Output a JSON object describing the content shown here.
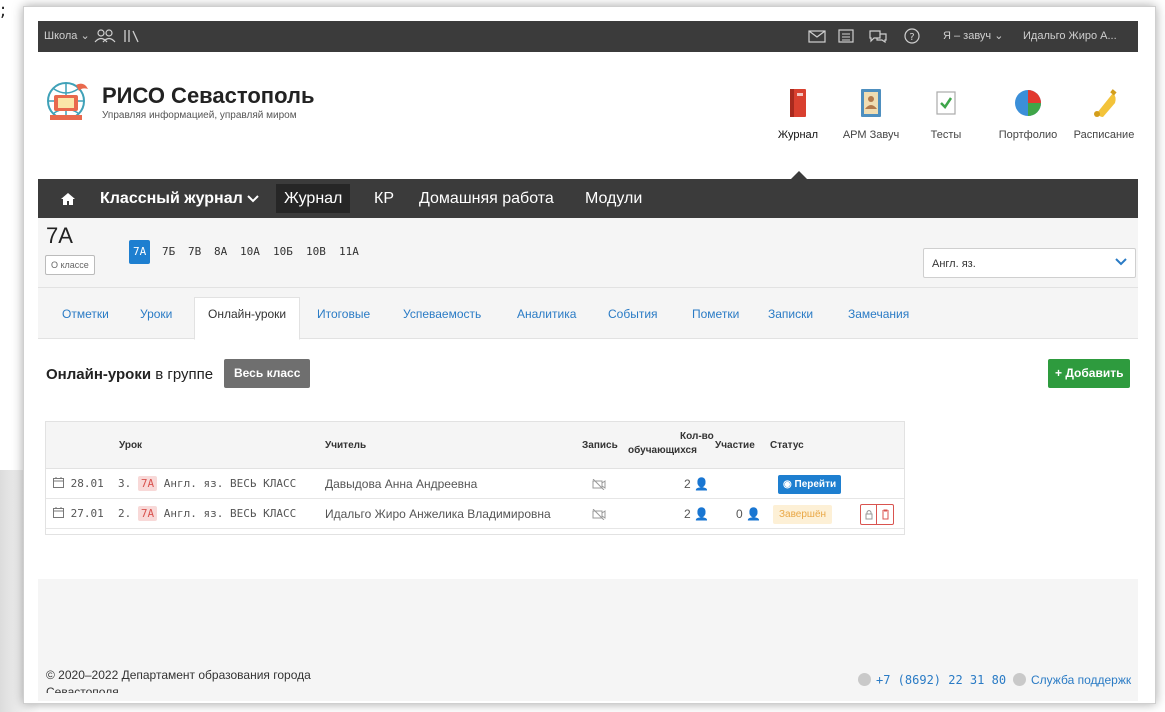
{
  "topbar": {
    "school_label": "Школа",
    "role_label": "Я – завуч",
    "user_name": "Идальго Жиро А..."
  },
  "header": {
    "title": "РИСО Севастополь",
    "subtitle": "Управляя информацией, управляй миром"
  },
  "modules": [
    {
      "label": "Журнал",
      "icon": "journal-icon"
    },
    {
      "label": "АРМ Завуч",
      "icon": "contacts-book-icon"
    },
    {
      "label": "Тесты",
      "icon": "checkmark-doc-icon"
    },
    {
      "label": "Портфолио",
      "icon": "pie-chart-icon"
    },
    {
      "label": "Расписание",
      "icon": "bell-icon"
    }
  ],
  "nav": {
    "class_journal": "Классный журнал",
    "items": [
      "Журнал",
      "КР",
      "Домашняя работа",
      "Модули"
    ]
  },
  "classbar": {
    "current_class": "7А",
    "about_button": "О классе",
    "classes": [
      "7А",
      "7Б",
      "7В",
      "8А",
      "10А",
      "10Б",
      "10В",
      "11А"
    ],
    "subject_selected": "Англ. яз."
  },
  "tabs": [
    "Отметки",
    "Уроки",
    "Онлайн-уроки",
    "Итоговые",
    "Успеваемость",
    "Аналитика",
    "События",
    "Пометки",
    "Записки",
    "Замечания"
  ],
  "section": {
    "title_bold": "Онлайн-уроки",
    "title_rest": " в группе",
    "group": "Весь класс",
    "add_button": "+ Добавить"
  },
  "table": {
    "headers": {
      "lesson": "Урок",
      "teacher": "Учитель",
      "record": "Запись",
      "count_line1": "Кол-во",
      "count_line2": "обучающихся",
      "participation": "Участие",
      "status": "Статус"
    },
    "rows": [
      {
        "date": "28.01",
        "num": "3.",
        "class": "7А",
        "subject": "Англ. яз. ВЕСЬ КЛАСС",
        "teacher": "Давыдова Анна Андреевна",
        "count": "2",
        "participation": "",
        "status": "Перейти",
        "status_type": "button"
      },
      {
        "date": "27.01",
        "num": "2.",
        "class": "7А",
        "subject": "Англ. яз. ВЕСЬ КЛАСС",
        "teacher": "Идальго Жиро Анжелика Владимировна",
        "count": "2",
        "participation": "0",
        "status": "Завершён",
        "status_type": "badge"
      }
    ]
  },
  "footer": {
    "copyright": "© 2020–2022 Департамент образования города",
    "copyright_line2": "Севастополя",
    "phone": "+7 (8692) 22 31 80",
    "support": "Служба поддержк"
  },
  "colors": {
    "dark_bar": "#3b3b3b",
    "link_blue": "#2a7bc5",
    "active_blue": "#1e7fd0",
    "add_green": "#2e9b3e",
    "done_orange": "#e9a745"
  }
}
